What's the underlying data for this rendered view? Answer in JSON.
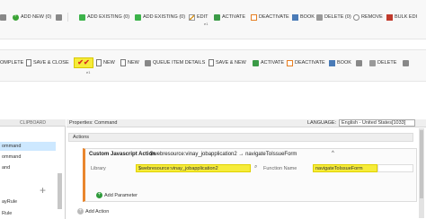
{
  "ribbon1": {
    "items": [
      {
        "label": "ADD NEW (0)",
        "icon": "add-new-icon"
      },
      {
        "label": "ADD EXISTING (0)",
        "icon": "add-existing-icon"
      },
      {
        "label": "ADD EXISTING (0)",
        "icon": "add-existing-icon"
      },
      {
        "label": "EDIT",
        "icon": "edit-icon"
      },
      {
        "label": "ACTIVATE",
        "icon": "activate-icon"
      },
      {
        "label": "DEACTIVATE",
        "icon": "deactivate-icon"
      },
      {
        "label": "BOOK",
        "icon": "book-icon"
      },
      {
        "label": "DELETE (0)",
        "icon": "delete-icon"
      },
      {
        "label": "REMOVE",
        "icon": "remove-icon"
      },
      {
        "label": "BULK EDI",
        "icon": "bulk-edit-icon"
      }
    ],
    "edit_badge": "e1"
  },
  "ribbon2": {
    "items": [
      {
        "label": "OMPLETE"
      },
      {
        "label": "SAVE & CLOSE"
      },
      {
        "label": "NEW"
      },
      {
        "label": "NEW"
      },
      {
        "label": "QUEUE ITEM DETAILS"
      },
      {
        "label": "SAVE & NEW"
      },
      {
        "label": "ACTIVATE"
      },
      {
        "label": "DEACTIVATE"
      },
      {
        "label": "BOOK"
      },
      {
        "label": "DELETE"
      }
    ],
    "check_badge": "e1"
  },
  "sidebar": {
    "header": "CLIPBOARD",
    "items": [
      "ommand",
      "ommand",
      "and",
      "ayRule",
      "Rule"
    ]
  },
  "properties": {
    "title": "Properties: Command",
    "language_label": "LANGUAGE:",
    "language_value": "English - United States[1033]"
  },
  "actions": {
    "label": "Actions",
    "card": {
      "title": "Custom Javascript Action",
      "subtitle": "$webresource:vinay_jobapplication2 → navigateToIssueForm",
      "caret": "^",
      "library_label": "Library",
      "library_value": "$webresource:vinay_jobapplication2",
      "function_label": "Function Name",
      "function_value": "navigateToIssueForm",
      "add_param_label": "Add Parameter"
    },
    "add_action_label": "Add Action"
  },
  "colors": {
    "highlight": "#f6ec3a",
    "accent_orange": "#e9862d",
    "selection": "#cde8ff"
  }
}
